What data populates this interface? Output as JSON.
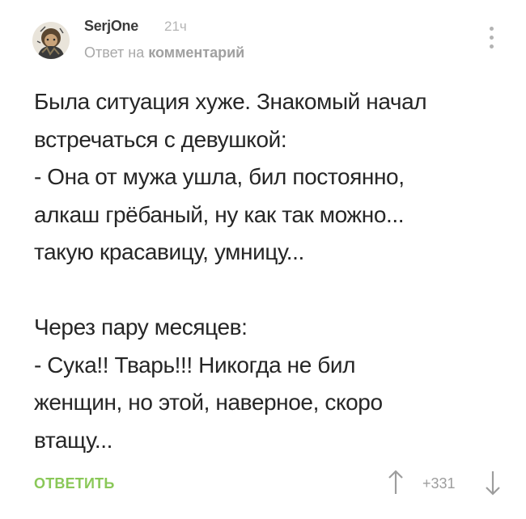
{
  "comment": {
    "author": "SerjOne",
    "time": "21ч",
    "reply_prefix": "Ответ на",
    "reply_link": "комментарий",
    "body_lines": [
      "Была ситуация хуже. Знакомый начал",
      "встречаться с девушкой:",
      "- Она от мужа ушла, бил постоянно,",
      "алкаш грёбаный, ну как так можно...",
      "такую красавицу, умницу..."
    ],
    "body_lines_2": [
      "Через пару месяцев:",
      "- Сука!! Тварь!!! Никогда не бил",
      "женщин, но этой, наверное, скоро",
      "втащу..."
    ],
    "reply_button": "ОТВЕТИТЬ",
    "rating": "+331"
  },
  "icons": {
    "avatar": "avatar-image",
    "menu": "more-vertical-icon",
    "up": "arrow-up-icon",
    "down": "arrow-down-icon"
  },
  "colors": {
    "author": "#3b3b3b",
    "meta": "#a8a8a8",
    "text": "#262626",
    "reply_button": "#8ac858",
    "icon": "#9d9d9d"
  }
}
